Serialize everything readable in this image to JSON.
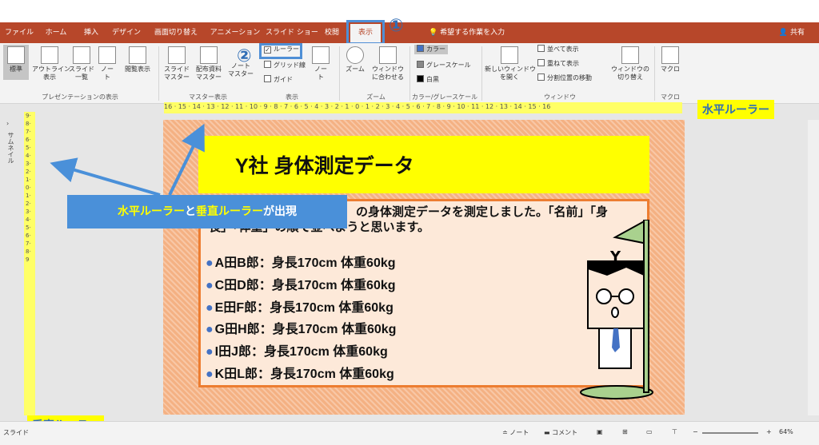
{
  "tabs": [
    "ファイル",
    "ホーム",
    "挿入",
    "デザイン",
    "画面切り替え",
    "アニメーション",
    "スライド ショー",
    "校閲",
    "表示"
  ],
  "tell_me": "希望する作業を入力",
  "share": "共有",
  "ribbon": {
    "views": [
      "標準",
      "アウトライン\n表示",
      "スライド\n一覧",
      "ノー\nト",
      "閲覧表示"
    ],
    "masters": [
      "スライド\nマスター",
      "配布資料\nマスター",
      "ノート\nマスター"
    ],
    "show_items": [
      "ルーラー",
      "グリッド線",
      "ガイド"
    ],
    "notes": "ノー\nト",
    "zoom": [
      "ズーム",
      "ウィンドウ\nに合わせる"
    ],
    "color": [
      "カラー",
      "グレースケール",
      "白黒"
    ],
    "window": [
      "新しいウィンドウ\nを開く",
      "並べて表示",
      "重ねて表示",
      "分割位置の移動",
      "ウィンドウの\n切り替え"
    ],
    "macro": "マクロ",
    "groups": [
      "プレゼンテーションの表示",
      "マスター表示",
      "表示",
      "ズーム",
      "カラー/グレースケール",
      "ウィンドウ",
      "マクロ"
    ]
  },
  "callouts": {
    "one": "①",
    "two": "②"
  },
  "labels": {
    "h_ruler": "水平ルーラー",
    "v_ruler": "垂直ルーラー",
    "thumbnail": "サムネイル"
  },
  "banner": {
    "part1": "水平ルーラー",
    "part2": "と",
    "part3": "垂直ルーラー",
    "part4": "が出現"
  },
  "ruler_h": "16 · 15 · 14 · 13 · 12 · 11 · 10 · 9 · 8 · 7 · 6 · 5 · 4 · 3 · 2 · 1 · 0 · 1 · 2 · 3 · 4 · 5 · 6 · 7 · 8 · 9 · 10 · 11 · 12 · 13 · 14 · 15 · 16",
  "ruler_v": "9·8·7·6·5·4·3·2·1·0·1·2·3·4·5·6·7·8·9",
  "slide": {
    "title": "Y社 身体測定データ",
    "body_line1": "の身体測定データを測定しました。「名前」「身",
    "body_line2": "長」「体重」の順で並べようと思います。",
    "bullets": [
      "A田B郎：身長170cm 体重60kg",
      "C田D郎：身長170cm 体重60kg",
      "E田F郎：身長170cm 体重60kg",
      "G田H郎：身長170cm 体重60kg",
      "I田J郎：身長170cm 体重60kg",
      "K田L郎：身長170cm 体重60kg"
    ]
  },
  "status": {
    "slide": "スライド",
    "notes": "ノート",
    "comments": "コメント",
    "zoom": "64%"
  }
}
